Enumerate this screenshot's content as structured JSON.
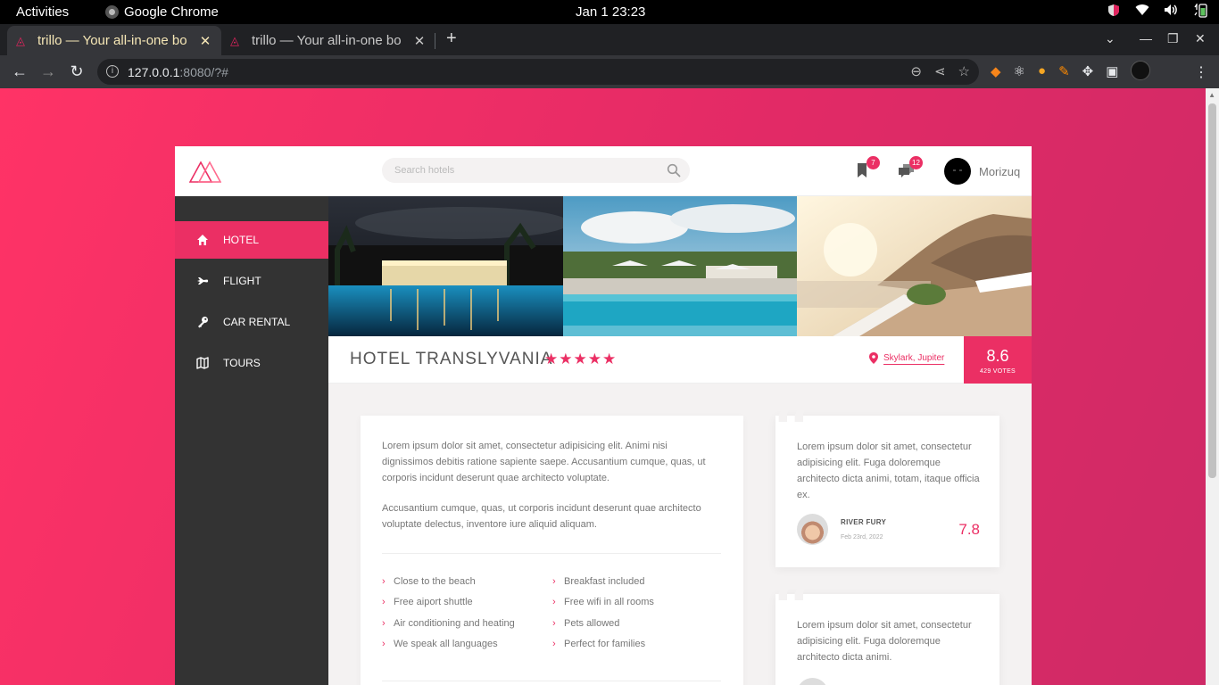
{
  "os": {
    "activities": "Activities",
    "app_name": "Google Chrome",
    "clock": "Jan 1  23:23"
  },
  "browser": {
    "tabs": [
      {
        "title": "trillo — Your all-in-one bo",
        "active": true
      },
      {
        "title": "trillo — Your all-in-one bo",
        "active": false
      }
    ],
    "url_host": "127.0.0.1",
    "url_rest": ":8080/?#"
  },
  "header": {
    "search_placeholder": "Search hotels",
    "bookmark_count": "7",
    "chat_count": "12",
    "user_name": "Morizuq"
  },
  "sidebar": {
    "items": [
      {
        "label": "HOTEL",
        "icon": "home-icon",
        "active": true
      },
      {
        "label": "FLIGHT",
        "icon": "aircraft-icon",
        "active": false
      },
      {
        "label": "CAR RENTAL",
        "icon": "key-icon",
        "active": false
      },
      {
        "label": "TOURS",
        "icon": "map-icon",
        "active": false
      }
    ]
  },
  "overview": {
    "hotel_name": "HOTEL TRANSLYVANIA",
    "stars": "★★★★★",
    "location": "Skylark, Jupiter",
    "rating_average": "8.6",
    "rating_count": "429 VOTES"
  },
  "description": {
    "paragraph_1": "Lorem ipsum dolor sit amet, consectetur adipisicing elit. Animi nisi dignissimos debitis ratione sapiente saepe. Accusantium cumque, quas, ut corporis incidunt deserunt quae architecto voluptate.",
    "paragraph_2": "Accusantium cumque, quas, ut corporis incidunt deserunt quae architecto voluptate delectus, inventore iure aliquid aliquam.",
    "features": [
      "Close to the beach",
      "Breakfast included",
      "Free aiport shuttle",
      "Free wifi in all rooms",
      "Air conditioning and heating",
      "Pets allowed",
      "We speak all languages",
      "Perfect for families"
    ]
  },
  "reviews": [
    {
      "text": "Lorem ipsum dolor sit amet, consectetur adipisicing elit. Fuga doloremque architecto dicta animi, totam, itaque officia ex.",
      "name": "River Fury",
      "date": "Feb 23rd, 2022",
      "rating": "7.8"
    },
    {
      "text": "Lorem ipsum dolor sit amet, consectetur adipisicing elit. Fuga doloremque architecto dicta animi.",
      "name": "",
      "date": "",
      "rating": ""
    }
  ],
  "colors": {
    "primary": "#eb2f64",
    "sidebar": "#333333",
    "gradient_start": "#ff3366",
    "gradient_end": "#ce2a66"
  }
}
